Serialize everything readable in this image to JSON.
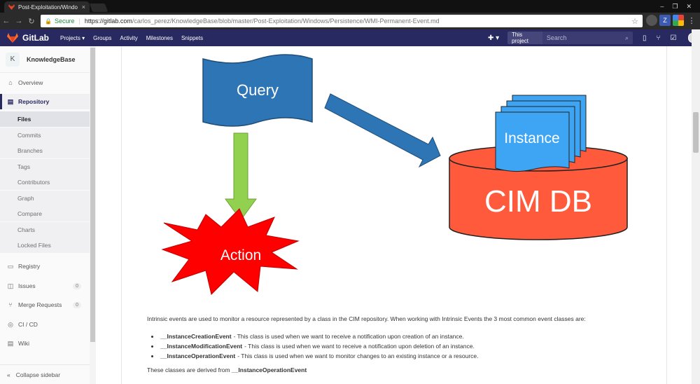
{
  "browser": {
    "tab_title": "Post-Exploitation/Windo",
    "tab_close": "×",
    "secure_label": "Secure",
    "url_host": "https://gitlab.com",
    "url_path": "/carlos_perez/KnowledgeBase/blob/master/Post-Exploitation/Windows/Persistence/WMI-Permanent-Event.md",
    "window_controls": [
      "–",
      "❐",
      "✕"
    ],
    "ext_letter": "Z"
  },
  "header": {
    "logo_text": "GitLab",
    "nav": [
      "Projects ▾",
      "Groups",
      "Activity",
      "Milestones",
      "Snippets"
    ],
    "plus_label": "✚ ▾",
    "search_scope": "This project",
    "search_placeholder": "Search"
  },
  "sidebar": {
    "project_initial": "K",
    "project_name": "KnowledgeBase",
    "overview": "Overview",
    "repository": "Repository",
    "repo_items": [
      "Files",
      "Commits",
      "Branches",
      "Tags",
      "Contributors",
      "Graph",
      "Compare",
      "Charts",
      "Locked Files"
    ],
    "registry": "Registry",
    "issues": "Issues",
    "issues_count": "0",
    "merge_requests": "Merge Requests",
    "mr_count": "0",
    "cicd": "CI / CD",
    "wiki": "Wiki",
    "collapse": "Collapse sidebar"
  },
  "diagram": {
    "query": "Query",
    "instance": "Instance",
    "cimdb": "CIM DB",
    "action": "Action"
  },
  "content": {
    "intro": "Intrinsic events are used to monitor a resource represented by a class in the CIM repository. When working with Intrinsic Events the 3 most common event classes are:",
    "bullets": [
      {
        "name": "__InstanceCreationEvent",
        "desc": "- This class is used when we want to receive a notification upon creation of an instance."
      },
      {
        "name": "__InstanceModificationEvent",
        "desc": "- This class is used when we want to receive a notification upon deletion of an instance."
      },
      {
        "name": "__InstanceOperationEvent",
        "desc": "- This class is used when we want to monitor changes to an existing instance or a resource."
      }
    ],
    "derived_prefix": "These classes are derived from",
    "derived_class": "__InstanceOperationEvent"
  },
  "colors": {
    "header_bg": "#292961",
    "query_blue": "#2e75b6",
    "arrow_green": "#92d050",
    "cimdb_red": "#ff5a3c",
    "action_red": "#ff0000",
    "instance_blue": "#3da5f4"
  }
}
